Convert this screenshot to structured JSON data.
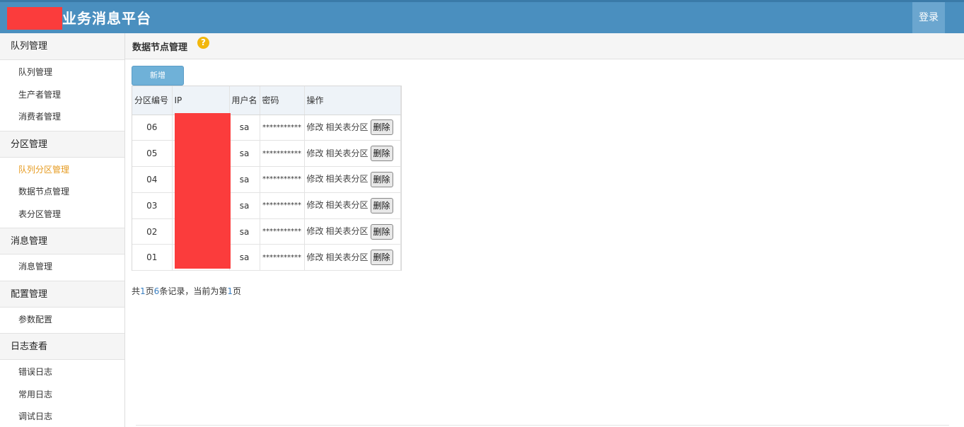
{
  "header": {
    "title": "业务消息平台",
    "login_label": "登录"
  },
  "sidebar": {
    "groups": [
      {
        "title": "队列管理",
        "items": [
          "队列管理",
          "生产者管理",
          "消费者管理"
        ]
      },
      {
        "title": "分区管理",
        "items": [
          "队列分区管理",
          "数据节点管理",
          "表分区管理"
        ]
      },
      {
        "title": "消息管理",
        "items": [
          "消息管理"
        ]
      },
      {
        "title": "配置管理",
        "items": [
          "参数配置"
        ]
      },
      {
        "title": "日志查看",
        "items": [
          "错误日志",
          "常用日志",
          "调试日志"
        ]
      }
    ],
    "active_item": "队列分区管理"
  },
  "main": {
    "page_title": "数据节点管理",
    "add_label": "新增",
    "table": {
      "headers": [
        "分区编号",
        "IP",
        "用户名",
        "密码",
        "操作"
      ],
      "rows": [
        {
          "id": "06",
          "user": "sa",
          "pwd": "***********"
        },
        {
          "id": "05",
          "user": "sa",
          "pwd": "***********"
        },
        {
          "id": "04",
          "user": "sa",
          "pwd": "***********"
        },
        {
          "id": "03",
          "user": "sa",
          "pwd": "***********"
        },
        {
          "id": "02",
          "user": "sa",
          "pwd": "***********"
        },
        {
          "id": "01",
          "user": "sa",
          "pwd": "***********"
        }
      ],
      "ops": {
        "edit": "修改",
        "related": "相关表分区",
        "delete": "删除"
      }
    },
    "pager": {
      "prefix": "共",
      "pages": "1",
      "page_word": "页",
      "records": "6",
      "records_word": "条记录，当前为第",
      "current": "1",
      "suffix": "页"
    }
  },
  "colors": {
    "header_bg": "#4a8fbf",
    "active": "#e69a1e",
    "redaction": "#fb3c3c"
  },
  "icons": {
    "help": "question-circle-icon"
  }
}
